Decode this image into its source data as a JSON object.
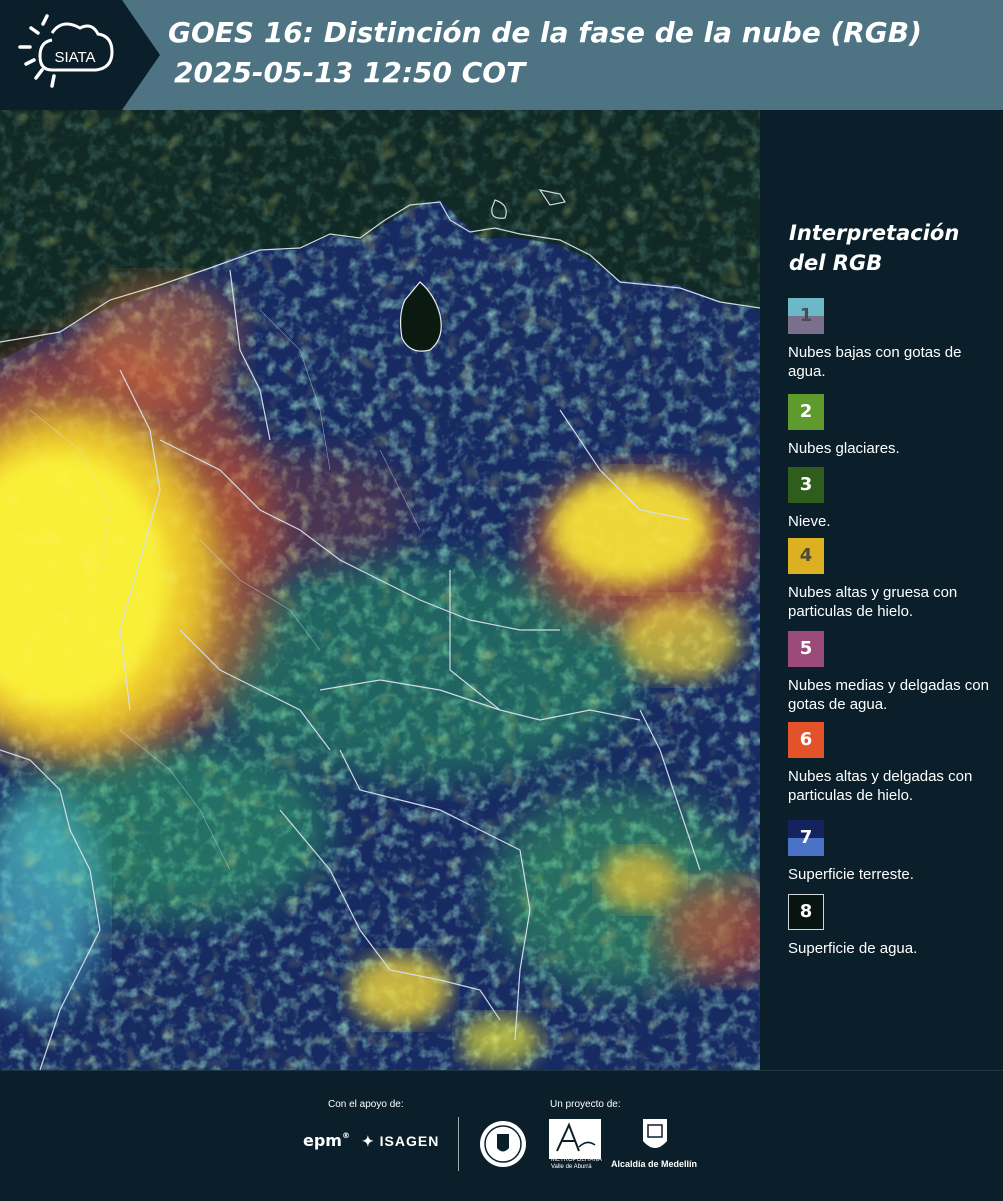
{
  "header": {
    "logo_text": "SIATA",
    "title_line1": "GOES 16: Distinción de la fase de la nube (RGB)",
    "title_line2": "2025-05-13 12:50 COT"
  },
  "legend": {
    "title_line1": "Interpretación",
    "title_line2": "del RGB",
    "items": [
      {
        "num": "1",
        "label": "Nubes bajas con gotas de agua.",
        "top_color": "#6bb8c6",
        "bottom_color": "#7a6f8c",
        "num_color": "#4a4a55"
      },
      {
        "num": "2",
        "label": "Nubes glaciares.",
        "top_color": "#5e9a2d",
        "bottom_color": "#5e9a2d",
        "num_color": "#ffffff"
      },
      {
        "num": "3",
        "label": "Nieve.",
        "top_color": "#2f5e1c",
        "bottom_color": "#2f5e1c",
        "num_color": "#ffffff"
      },
      {
        "num": "4",
        "label": "Nubes altas y gruesa con particulas de hielo.",
        "top_color": "#ddb022",
        "bottom_color": "#ddb022",
        "num_color": "#4a4a3a"
      },
      {
        "num": "5",
        "label": "Nubes medias y delgadas con gotas de agua.",
        "top_color": "#9b4a7a",
        "bottom_color": "#9b4a7a",
        "num_color": "#ffffff"
      },
      {
        "num": "6",
        "label": "Nubes altas y delgadas con particulas de hielo.",
        "top_color": "#e4522b",
        "bottom_color": "#e4522b",
        "num_color": "#ffffff"
      },
      {
        "num": "7",
        "label": "Superficie terreste.",
        "top_color": "#13235e",
        "bottom_color": "#4a72c4",
        "num_color": "#ffffff"
      },
      {
        "num": "8",
        "label": "Superficie de agua.",
        "top_color": "#081410",
        "bottom_color": "#081410",
        "num_color": "#ffffff"
      }
    ]
  },
  "footer": {
    "support_label": "Con el apoyo de:",
    "project_label": "Un proyecto de:",
    "epm": "epm",
    "isagen": "ISAGEN",
    "amva_line1": "METROPOLITANA",
    "amva_line2": "Valle de Aburrá",
    "alcaldia": "Alcaldía de Medellín"
  },
  "colors": {
    "header_bg": "#4e7483",
    "panel_bg": "#0b1f2b",
    "border_lines": "#d8e2ea"
  }
}
